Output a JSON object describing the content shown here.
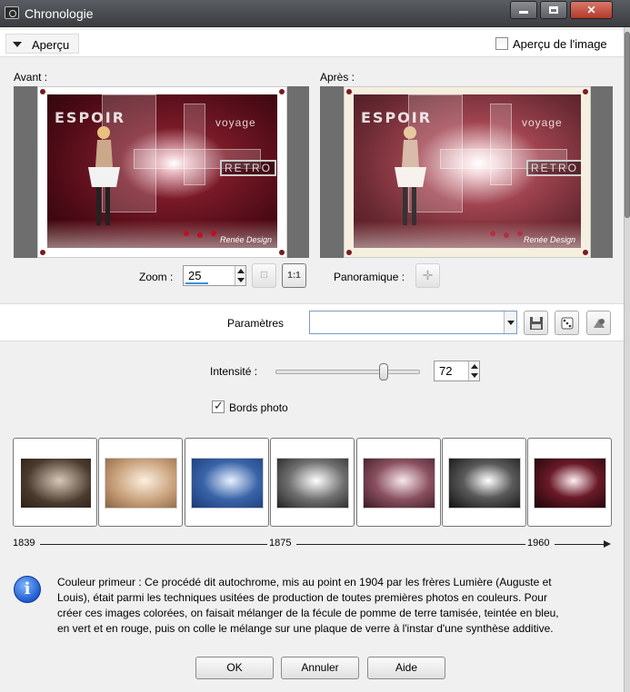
{
  "window": {
    "title": "Chronologie",
    "minimize_icon": "minimize-icon",
    "maximize_icon": "maximize-icon",
    "close_icon": "close-icon"
  },
  "preview": {
    "header_label": "Aperçu",
    "image_preview_label": "Aperçu de l'image",
    "image_preview_checked": false,
    "before_label": "Avant :",
    "after_label": "Après :",
    "photo_text": {
      "word": "ESPOIR",
      "voyage": "voyage",
      "retro": "RETRO",
      "signature": "Renée Design"
    }
  },
  "zoom": {
    "label": "Zoom :",
    "value": "25",
    "fit_button_icon": "fit-to-window-icon",
    "actual_size_button": "1:1"
  },
  "pan": {
    "label": "Panoramique :",
    "icon": "pan-cross-icon"
  },
  "parameters": {
    "label": "Paramètres",
    "value": "",
    "save_icon": "floppy-disk-icon",
    "random_icon": "dice-icon",
    "reset_icon": "reset-icon"
  },
  "intensity": {
    "label": "Intensité :",
    "value": "72",
    "level": 0.72
  },
  "photo_borders": {
    "label": "Bords photo",
    "checked": true
  },
  "thumbnails": [
    {
      "style": "sepia-dark"
    },
    {
      "style": "sepia-light"
    },
    {
      "style": "cyanotype-blue"
    },
    {
      "style": "black-white"
    },
    {
      "style": "tinted-rose"
    },
    {
      "style": "grayscale-contrast"
    },
    {
      "style": "autochrome-color"
    }
  ],
  "timeline": {
    "start": "1839",
    "middle": "1875",
    "end": "1960"
  },
  "info": {
    "icon": "info-icon",
    "lines": [
      "Couleur primeur : Ce procédé dit autochrome, mis au point en 1904 par les frères Lumière (Auguste et",
      "Louis), était parmi les  techniques usitées de production de toutes premières photos en couleurs. Pour",
      "créer ces images colorées, on faisait mélanger de la fécule de pomme de terre tamisée, teintée en bleu,",
      "en vert et en rouge, puis on colle le mélange sur une plaque de verre à l'instar d'une synthèse additive."
    ]
  },
  "buttons": {
    "ok": "OK",
    "cancel": "Annuler",
    "help": "Aide"
  },
  "colors": {
    "photo_dark_red": "#4a0a15",
    "accent_blue": "#3c8ee0",
    "info_blue": "#1e5bd0"
  }
}
